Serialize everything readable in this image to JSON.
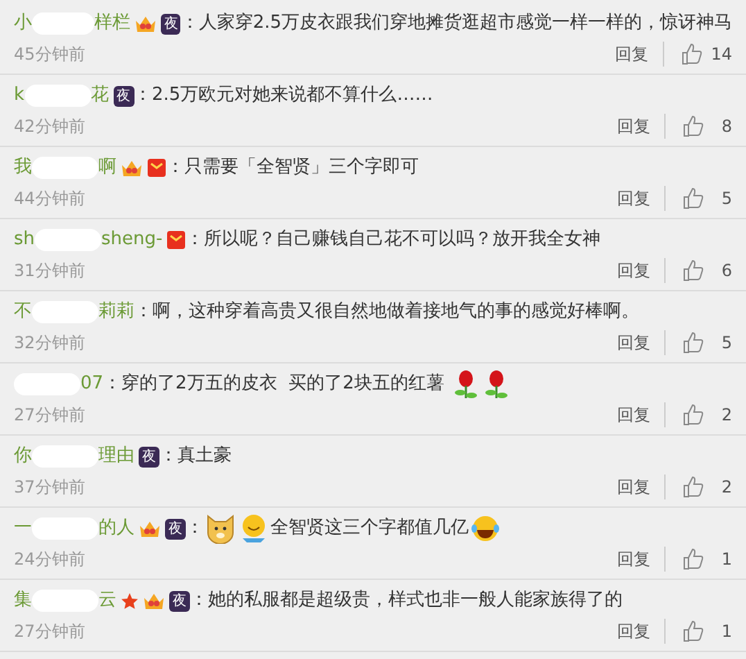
{
  "comments": [
    {
      "name_start": "小",
      "name_end": "样栏",
      "badges": [
        {
          "kind": "vip"
        },
        {
          "kind": "night",
          "text": "夜"
        }
      ],
      "content": [
        {
          "kind": "text",
          "text": "：人家穿2.5万皮衣跟我们穿地摊货逛超市感觉一样一样的，惊讶神马"
        }
      ],
      "time": "45分钟前",
      "reply": "回复",
      "likes": "14"
    },
    {
      "name_start": "k",
      "name_end": "花",
      "badges": [
        {
          "kind": "night",
          "text": "夜"
        }
      ],
      "content": [
        {
          "kind": "text",
          "text": "：2.5万欧元对她来说都不算什么……"
        }
      ],
      "time": "42分钟前",
      "reply": "回复",
      "likes": "8"
    },
    {
      "name_start": "我",
      "name_end": "啊",
      "badges": [
        {
          "kind": "vip"
        },
        {
          "kind": "envelope"
        }
      ],
      "content": [
        {
          "kind": "text",
          "text": "：只需要「全智贤」三个字即可"
        }
      ],
      "time": "44分钟前",
      "reply": "回复",
      "likes": "5"
    },
    {
      "name_start": "sh",
      "name_end": "sheng-",
      "badges": [
        {
          "kind": "envelope"
        }
      ],
      "content": [
        {
          "kind": "text",
          "text": "：所以呢？自己赚钱自己花不可以吗？放开我全女神"
        }
      ],
      "time": "31分钟前",
      "reply": "回复",
      "likes": "6"
    },
    {
      "name_start": "不",
      "name_end": "莉莉",
      "content": [
        {
          "kind": "text",
          "text": "：啊，这种穿着高贵又很自然地做着接地气的事的感觉好棒啊。"
        }
      ],
      "time": "32分钟前",
      "reply": "回复",
      "likes": "5"
    },
    {
      "name_end": "07",
      "content": [
        {
          "kind": "text",
          "text": "：穿的了2万五的皮衣  买的了2块五的红薯 "
        },
        {
          "kind": "rose"
        },
        {
          "kind": "rose"
        }
      ],
      "time": "27分钟前",
      "reply": "回复",
      "likes": "2"
    },
    {
      "name_start": "你",
      "name_end": "理由",
      "badges": [
        {
          "kind": "night",
          "text": "夜"
        }
      ],
      "content": [
        {
          "kind": "text",
          "text": "：真土豪"
        }
      ],
      "time": "37分钟前",
      "reply": "回复",
      "likes": "2"
    },
    {
      "name_start": "一",
      "name_end": "的人",
      "badges": [
        {
          "kind": "vip"
        },
        {
          "kind": "night",
          "text": "夜"
        }
      ],
      "content": [
        {
          "kind": "text",
          "text": "："
        },
        {
          "kind": "dog"
        },
        {
          "kind": "smile"
        },
        {
          "kind": "text",
          "text": "全智贤这三个字都值几亿"
        },
        {
          "kind": "laugh"
        }
      ],
      "time": "24分钟前",
      "reply": "回复",
      "likes": "1"
    },
    {
      "name_start": "集",
      "name_end": "云",
      "badges": [
        {
          "kind": "star"
        },
        {
          "kind": "vip"
        },
        {
          "kind": "night",
          "text": "夜"
        }
      ],
      "content": [
        {
          "kind": "text",
          "text": "：她的私服都是超级贵，样式也非一般人能家族得了的"
        }
      ],
      "time": "27分钟前",
      "reply": "回复",
      "likes": "1"
    }
  ]
}
